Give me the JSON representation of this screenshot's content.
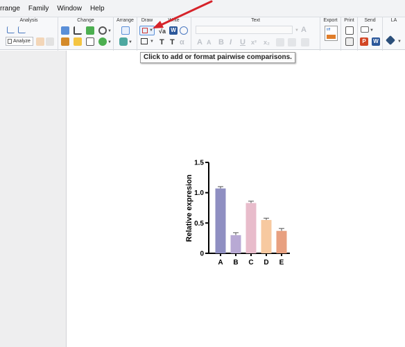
{
  "menu": [
    "rrange",
    "Family",
    "Window",
    "Help"
  ],
  "ribbon": {
    "groups": [
      "Analysis",
      "Change",
      "Arrange",
      "Draw",
      "Write",
      "Text",
      "Export",
      "Print",
      "Send",
      "LA"
    ],
    "analyze_label": "Analyze",
    "export_badge": "tiff",
    "send_p": "P",
    "send_w": "W",
    "write_w": "W",
    "write_sqrt": "√a",
    "write_t1": "T",
    "write_t2": "T",
    "write_alpha": "α",
    "text_glyphs": [
      "A",
      "A",
      "B",
      "I",
      "U",
      "x²",
      "x₂"
    ]
  },
  "tooltip": "Click to add or format pairwise comparisons.",
  "colors": {
    "bar_A": "#8f8fc2",
    "bar_B": "#b8a9d4",
    "bar_C": "#e8bccb",
    "bar_D": "#f7c9a0",
    "bar_E": "#e8a080",
    "arrow": "#d6232a"
  },
  "chart_data": {
    "type": "bar",
    "categories": [
      "A",
      "B",
      "C",
      "D",
      "E"
    ],
    "values": [
      1.07,
      0.3,
      0.83,
      0.55,
      0.37
    ],
    "errors": [
      0.03,
      0.04,
      0.03,
      0.03,
      0.04
    ],
    "ylabel": "Relative expresion",
    "yticks": [
      "0",
      "0.5",
      "1.0",
      "1.5"
    ],
    "ylim": [
      0,
      1.5
    ]
  }
}
